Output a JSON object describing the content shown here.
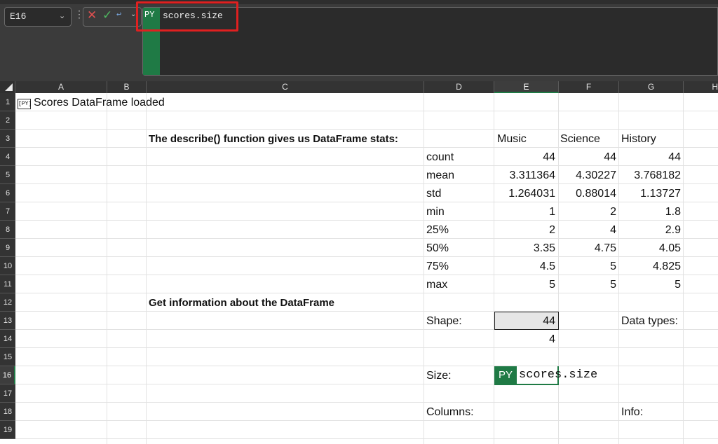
{
  "formula_bar": {
    "name_box": "E16",
    "py_label": "PY",
    "formula": "scores.size"
  },
  "columns": [
    "A",
    "B",
    "C",
    "D",
    "E",
    "F",
    "G",
    "H"
  ],
  "rows": [
    "1",
    "2",
    "3",
    "4",
    "5",
    "6",
    "7",
    "8",
    "9",
    "10",
    "11",
    "12",
    "13",
    "14",
    "15",
    "16",
    "17",
    "18",
    "19"
  ],
  "cells": {
    "a1_badge": "[PY]",
    "a1": "Scores DataFrame loaded",
    "c3": "The describe() function gives us DataFrame stats:",
    "c12": "Get information about the DataFrame",
    "describe": {
      "headers": [
        "Music",
        "Science",
        "History"
      ],
      "rows": [
        {
          "label": "count",
          "values": [
            "44",
            "44",
            "44"
          ]
        },
        {
          "label": "mean",
          "values": [
            "3.311364",
            "4.30227",
            "3.768182"
          ]
        },
        {
          "label": "std",
          "values": [
            "1.264031",
            "0.88014",
            "1.13727"
          ]
        },
        {
          "label": "min",
          "values": [
            "1",
            "2",
            "1.8"
          ]
        },
        {
          "label": "25%",
          "values": [
            "2",
            "4",
            "2.9"
          ]
        },
        {
          "label": "50%",
          "values": [
            "3.35",
            "4.75",
            "4.05"
          ]
        },
        {
          "label": "75%",
          "values": [
            "4.5",
            "5",
            "4.825"
          ]
        },
        {
          "label": "max",
          "values": [
            "5",
            "5",
            "5"
          ]
        }
      ]
    },
    "d13": "Shape:",
    "e13": "44",
    "e14": "4",
    "g13": "Data types:",
    "d16": "Size:",
    "e16_py": "PY",
    "e16_formula": "scores.size",
    "d18": "Columns:",
    "g18": "Info:"
  },
  "colors": {
    "python_green": "#1f7a45",
    "highlight_red": "#e02020"
  }
}
